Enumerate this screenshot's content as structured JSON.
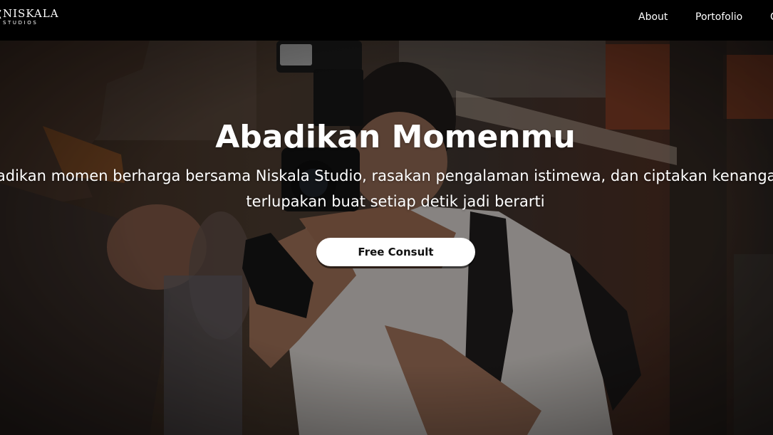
{
  "brand": {
    "name": "NISKALA",
    "tagline": "STUDIOS"
  },
  "nav": {
    "items": [
      {
        "label": "About"
      },
      {
        "label": "Portofolio"
      },
      {
        "label": "C"
      }
    ]
  },
  "hero": {
    "title": "Abadikan Momenmu",
    "description_line1": "Abadikan momen berharga bersama Niskala Studio, rasakan pengalaman istimewa, dan ciptakan kenangan tak",
    "description_line2": "terlupakan buat setiap detik jadi berarti",
    "cta_label": "Free Consult"
  },
  "colors": {
    "navbar_bg": "#000000",
    "text": "#ffffff",
    "cta_bg": "#ffffff",
    "cta_text": "#111111"
  }
}
